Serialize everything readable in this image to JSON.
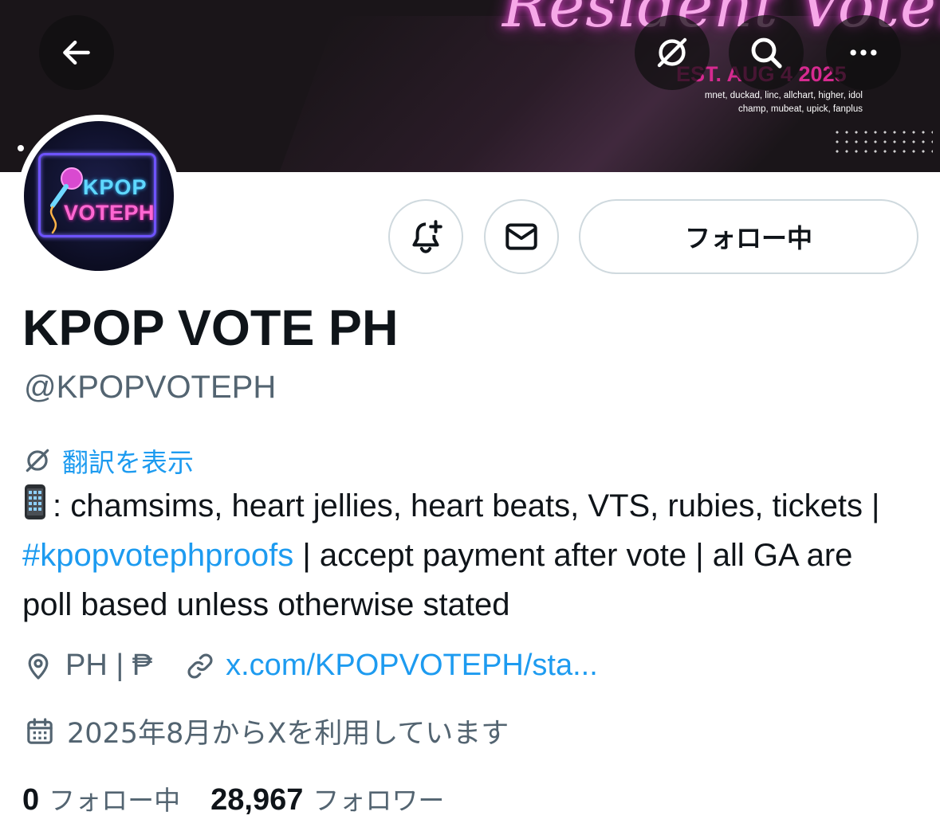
{
  "banner": {
    "script_text": "Resident Voter",
    "est_text": "EST. AUG 4 2025",
    "platforms_line1": "mnet, duckad, linc, allchart, higher, idol",
    "platforms_line2": "champ, mubeat, upick, fanplus"
  },
  "avatar": {
    "line1": "KPOP",
    "line2": "VOTEPH"
  },
  "actions": {
    "follow_label": "フォロー中"
  },
  "profile": {
    "display_name": "KPOP VOTE PH",
    "handle": "@KPOPVOTEPH",
    "translate_label": "翻訳を表示",
    "bio_part1": ": chamsims, heart jellies, heart beats, VTS, rubies, tickets | ",
    "bio_hashtag": "#kpopvotephproofs",
    "bio_part2": " | accept payment after vote | all GA are poll based unless otherwise stated",
    "location": "PH | ₱",
    "website": "x.com/KPOPVOTEPH/sta...",
    "joined": "2025年8月からXを利用しています"
  },
  "stats": {
    "following_count": "0",
    "following_label": "フォロー中",
    "followers_count": "28,967",
    "followers_label": "フォロワー"
  },
  "icons": {
    "back": "back-arrow-icon",
    "translate": "translate-icon",
    "search": "search-icon",
    "more": "more-icon",
    "notify": "bell-plus-icon",
    "message": "envelope-icon",
    "location": "location-pin-icon",
    "link": "link-icon",
    "calendar": "calendar-icon"
  },
  "colors": {
    "link_blue": "#1d9bf0",
    "secondary_text": "#536471",
    "primary_text": "#0f1419",
    "border": "#cfd9de"
  }
}
